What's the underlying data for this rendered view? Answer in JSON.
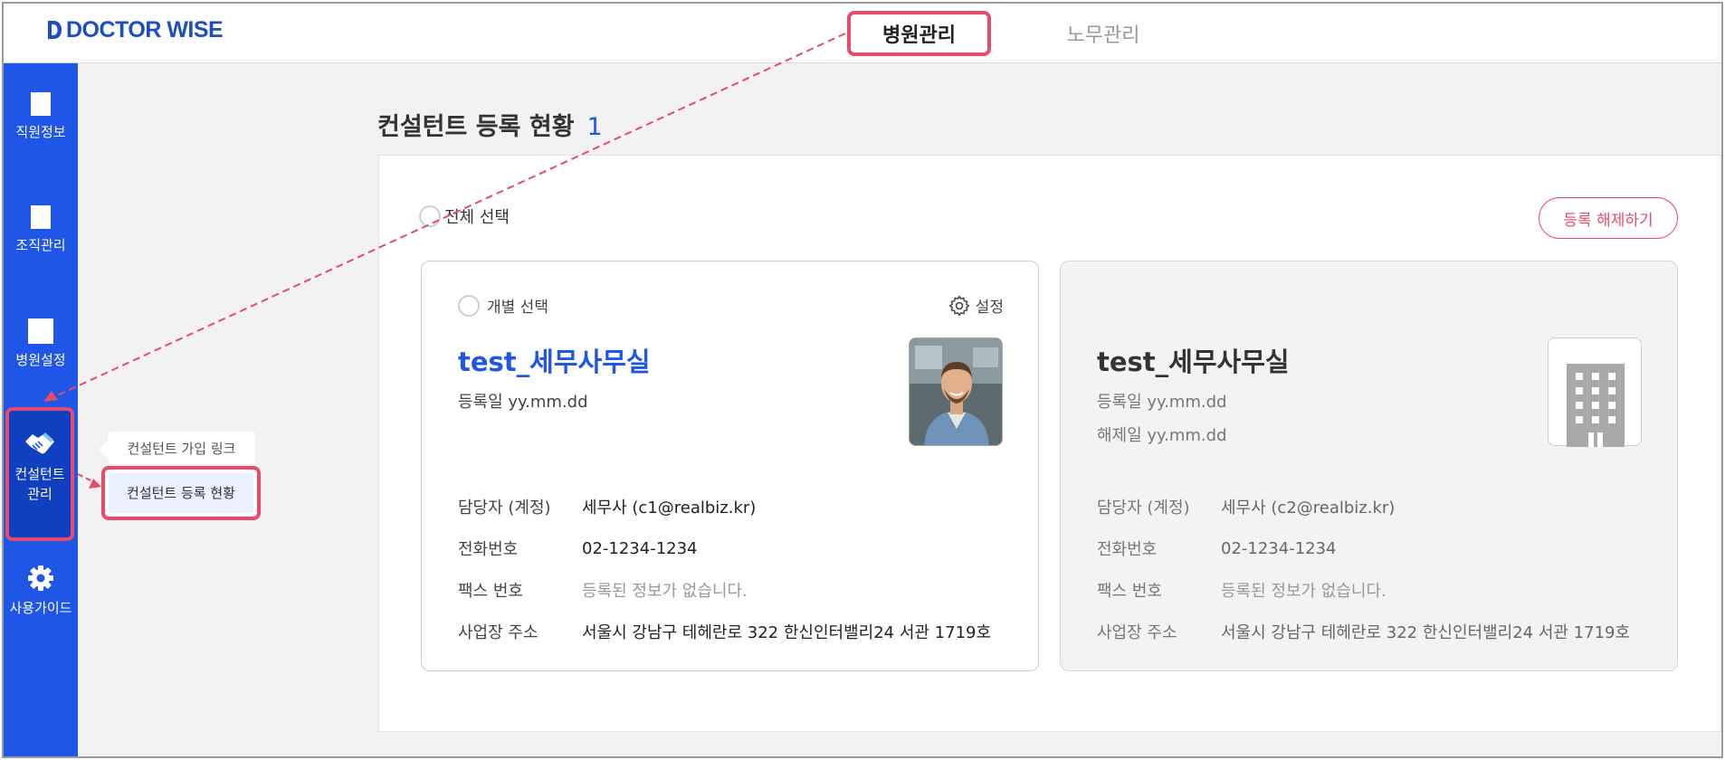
{
  "app": {
    "logo_text": "DOCTOR WISE"
  },
  "top_tabs": [
    {
      "label": "병원관리",
      "active": true
    },
    {
      "label": "노무관리",
      "active": false
    }
  ],
  "sidebar": {
    "items": [
      {
        "label": "직원정보",
        "icon": "document-icon"
      },
      {
        "label": "조직관리",
        "icon": "document-icon"
      },
      {
        "label": "병원설정",
        "icon": "square-icon"
      },
      {
        "label_line1": "컨설턴트",
        "label_line2": "관리",
        "icon": "handshake-icon",
        "active": true
      },
      {
        "label": "사용가이드",
        "icon": "gear-icon"
      }
    ],
    "submenu": {
      "join_link": "컨설턴트 가입 링크",
      "status": "컨설턴트 등록 현황"
    }
  },
  "main": {
    "title": "컨설턴트 등록 현황",
    "count": "1",
    "select_all": "전체 선택",
    "unregister_button": "등록 해제하기",
    "cards": [
      {
        "select_label": "개별 선택",
        "settings_label": "설정",
        "name": "test_세무사무실",
        "registered": "등록일 yy.mm.dd",
        "rows": [
          {
            "label": "담당자 (계정)",
            "value": "세무사 (c1@realbiz.kr)"
          },
          {
            "label": "전화번호",
            "value": "02-1234-1234"
          },
          {
            "label": "팩스 번호",
            "value": "등록된 정보가 없습니다."
          },
          {
            "label": "사업장 주소",
            "value": "서울시 강남구 테헤란로 322 한신인터밸리24 서관 1719호"
          }
        ]
      },
      {
        "name": "test_세무사무실",
        "registered": "등록일 yy.mm.dd",
        "unregistered": "해제일 yy.mm.dd",
        "rows": [
          {
            "label": "담당자 (계정)",
            "value": "세무사 (c2@realbiz.kr)"
          },
          {
            "label": "전화번호",
            "value": "02-1234-1234"
          },
          {
            "label": "팩스 번호",
            "value": "등록된 정보가 없습니다."
          },
          {
            "label": "사업장 주소",
            "value": "서울시 강남구 테헤란로 322 한신인터밸리24 서관 1719호"
          }
        ]
      }
    ]
  },
  "colors": {
    "brand_blue": "#1f56e8",
    "highlight_pink": "#e84a6b"
  }
}
